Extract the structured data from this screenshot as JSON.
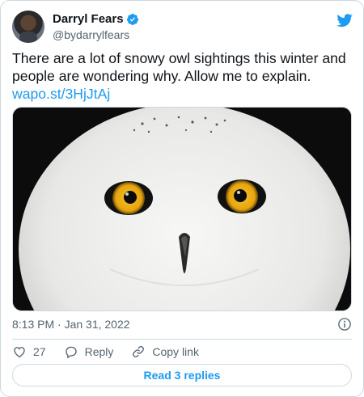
{
  "author": {
    "display_name": "Darryl Fears",
    "handle": "@bydarrylfears",
    "verified": true
  },
  "tweet": {
    "text": "There are a lot of snowy owl sightings this winter and people are wondering why. Allow me to explain.",
    "link": "wapo.st/3HjJtAj"
  },
  "meta": {
    "timestamp": "8:13 PM · Jan 31, 2022"
  },
  "actions": {
    "like_count": "27",
    "reply_label": "Reply",
    "copy_link_label": "Copy link"
  },
  "read_replies_label": "Read 3 replies",
  "colors": {
    "accent": "#1d9bf0",
    "secondary_text": "#536471",
    "border": "#cfd9de"
  },
  "icons": [
    "verified-badge-icon",
    "twitter-bird-icon",
    "info-icon",
    "heart-icon",
    "reply-icon",
    "link-icon"
  ]
}
